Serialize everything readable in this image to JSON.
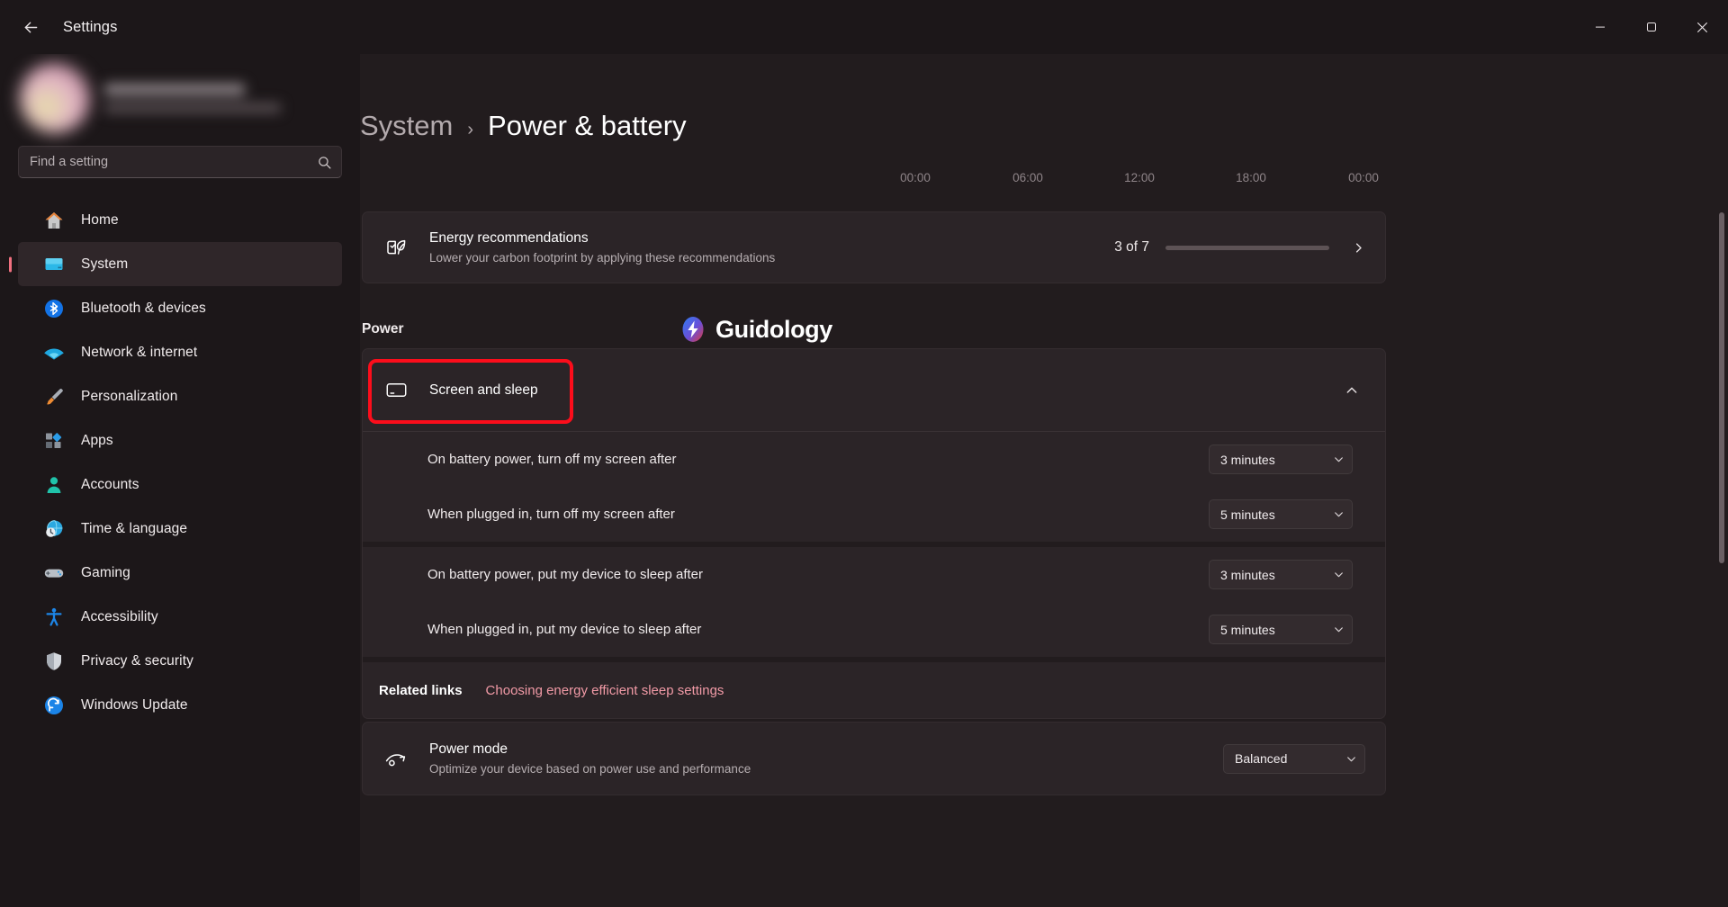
{
  "titlebar": {
    "back_icon": "back-arrow-icon",
    "title": "Settings",
    "minimize_label": "─",
    "maximize_label": "☐",
    "close_label": "✕"
  },
  "sidebar": {
    "search": {
      "placeholder": "Find a setting",
      "value": "",
      "icon": "search-icon"
    },
    "items": [
      {
        "label": "Home",
        "icon": "home-icon",
        "active": false
      },
      {
        "label": "System",
        "icon": "system-monitor-icon",
        "active": true
      },
      {
        "label": "Bluetooth & devices",
        "icon": "bluetooth-icon",
        "active": false
      },
      {
        "label": "Network & internet",
        "icon": "wifi-icon",
        "active": false
      },
      {
        "label": "Personalization",
        "icon": "paintbrush-icon",
        "active": false
      },
      {
        "label": "Apps",
        "icon": "apps-icon",
        "active": false
      },
      {
        "label": "Accounts",
        "icon": "person-icon",
        "active": false
      },
      {
        "label": "Time & language",
        "icon": "clock-globe-icon",
        "active": false
      },
      {
        "label": "Gaming",
        "icon": "gamepad-icon",
        "active": false
      },
      {
        "label": "Accessibility",
        "icon": "accessibility-icon",
        "active": false
      },
      {
        "label": "Privacy & security",
        "icon": "shield-icon",
        "active": false
      },
      {
        "label": "Windows Update",
        "icon": "refresh-icon",
        "active": false
      }
    ]
  },
  "breadcrumb": {
    "parent": "System",
    "separator": "›",
    "current": "Power & battery"
  },
  "battery_chart": {
    "time_ticks": [
      "00:00",
      "06:00",
      "12:00",
      "18:00",
      "00:00"
    ]
  },
  "energy_recommendations": {
    "icon": "leaf-checklist-icon",
    "title": "Energy recommendations",
    "subtitle": "Lower your carbon footprint by applying these recommendations",
    "count_text": "3 of 7",
    "progress_completed": 3,
    "progress_total": 7,
    "progress_color": "#e8505f",
    "chevron": "chevron-right-icon"
  },
  "power_section": {
    "heading": "Power"
  },
  "watermark": {
    "text": "Guidology",
    "icon": "lightning-bolt-icon"
  },
  "screen_and_sleep": {
    "icon": "screen-sleep-icon",
    "label": "Screen and sleep",
    "expanded": true,
    "chevron": "chevron-up-icon",
    "highlight_color": "#fc0d1b",
    "settings": [
      {
        "label": "On battery power, turn off my screen after",
        "value": "3 minutes"
      },
      {
        "label": "When plugged in, turn off my screen after",
        "value": "5 minutes"
      },
      {
        "label": "On battery power, put my device to sleep after",
        "value": "3 minutes"
      },
      {
        "label": "When plugged in, put my device to sleep after",
        "value": "5 minutes"
      }
    ]
  },
  "related_links": {
    "label": "Related links",
    "link": "Choosing energy efficient sleep settings"
  },
  "power_mode": {
    "icon": "power-mode-icon",
    "title": "Power mode",
    "subtitle": "Optimize your device based on power use and performance",
    "value": "Balanced"
  }
}
